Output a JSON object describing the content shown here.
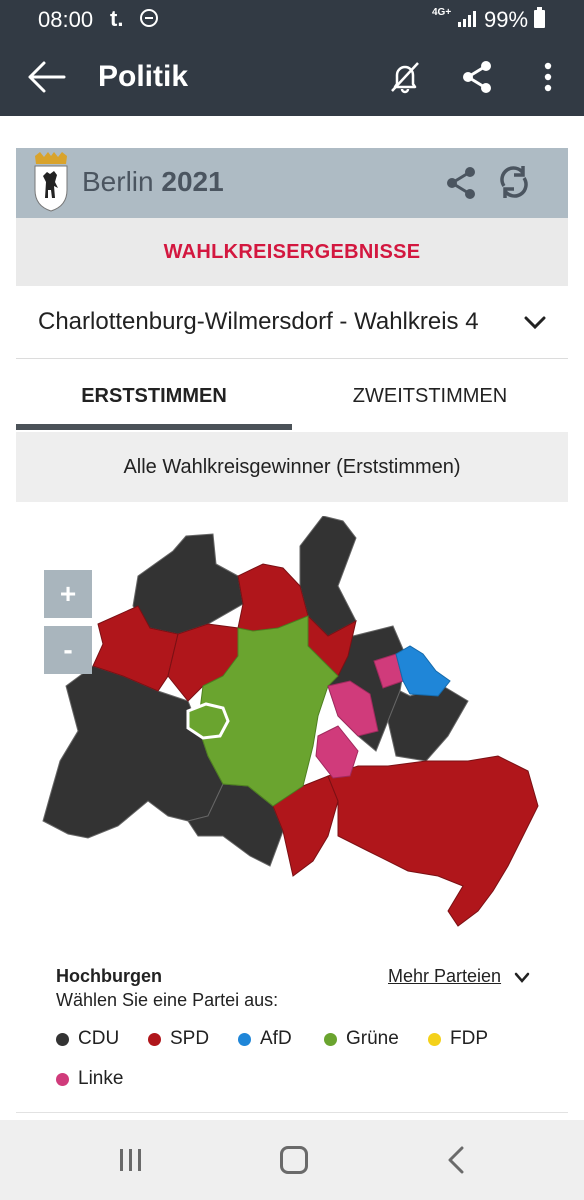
{
  "status_bar": {
    "time": "08:00",
    "carrier": "t.",
    "network": "4G+",
    "battery": "99%"
  },
  "app_bar": {
    "title": "Politik"
  },
  "card": {
    "state": "Berlin",
    "year": "2021",
    "section": "WAHLKREISERGEBNISSE"
  },
  "district_select": {
    "value": "Charlottenburg-Wilmersdorf - Wahlkreis 4"
  },
  "tabs": [
    {
      "label": "ERSTSTIMMEN",
      "selected": true
    },
    {
      "label": "ZWEITSTIMMEN",
      "selected": false
    }
  ],
  "winners_label": "Alle Wahlkreisgewinner (Erststimmen)",
  "map": {
    "zoom_in": "+",
    "zoom_out": "-"
  },
  "legend": {
    "heading": "Hochburgen",
    "subheading": "Wählen Sie eine Partei aus:",
    "more_parties": "Mehr Parteien",
    "parties": [
      {
        "name": "CDU",
        "color": "#333333"
      },
      {
        "name": "SPD",
        "color": "#b0161b"
      },
      {
        "name": "AfD",
        "color": "#1f86d8"
      },
      {
        "name": "Grüne",
        "color": "#6aa42f"
      },
      {
        "name": "FDP",
        "color": "#f4d11a"
      },
      {
        "name": "Linke",
        "color": "#d03b7b"
      }
    ]
  }
}
